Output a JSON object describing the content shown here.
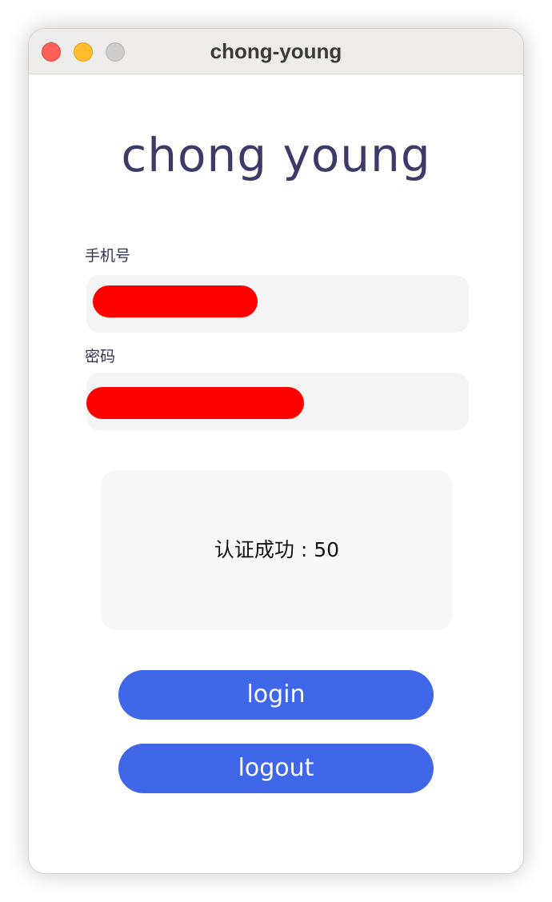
{
  "window": {
    "title": "chong-young"
  },
  "logo": {
    "text": "chong young"
  },
  "form": {
    "phone_label": "手机号",
    "password_label": "密码"
  },
  "status": {
    "message": "认证成功 : 50"
  },
  "buttons": {
    "login_label": "login",
    "logout_label": "logout"
  },
  "colors": {
    "button": "#3f67e8",
    "logo": "#3c3a66",
    "redaction": "#ff0000"
  }
}
